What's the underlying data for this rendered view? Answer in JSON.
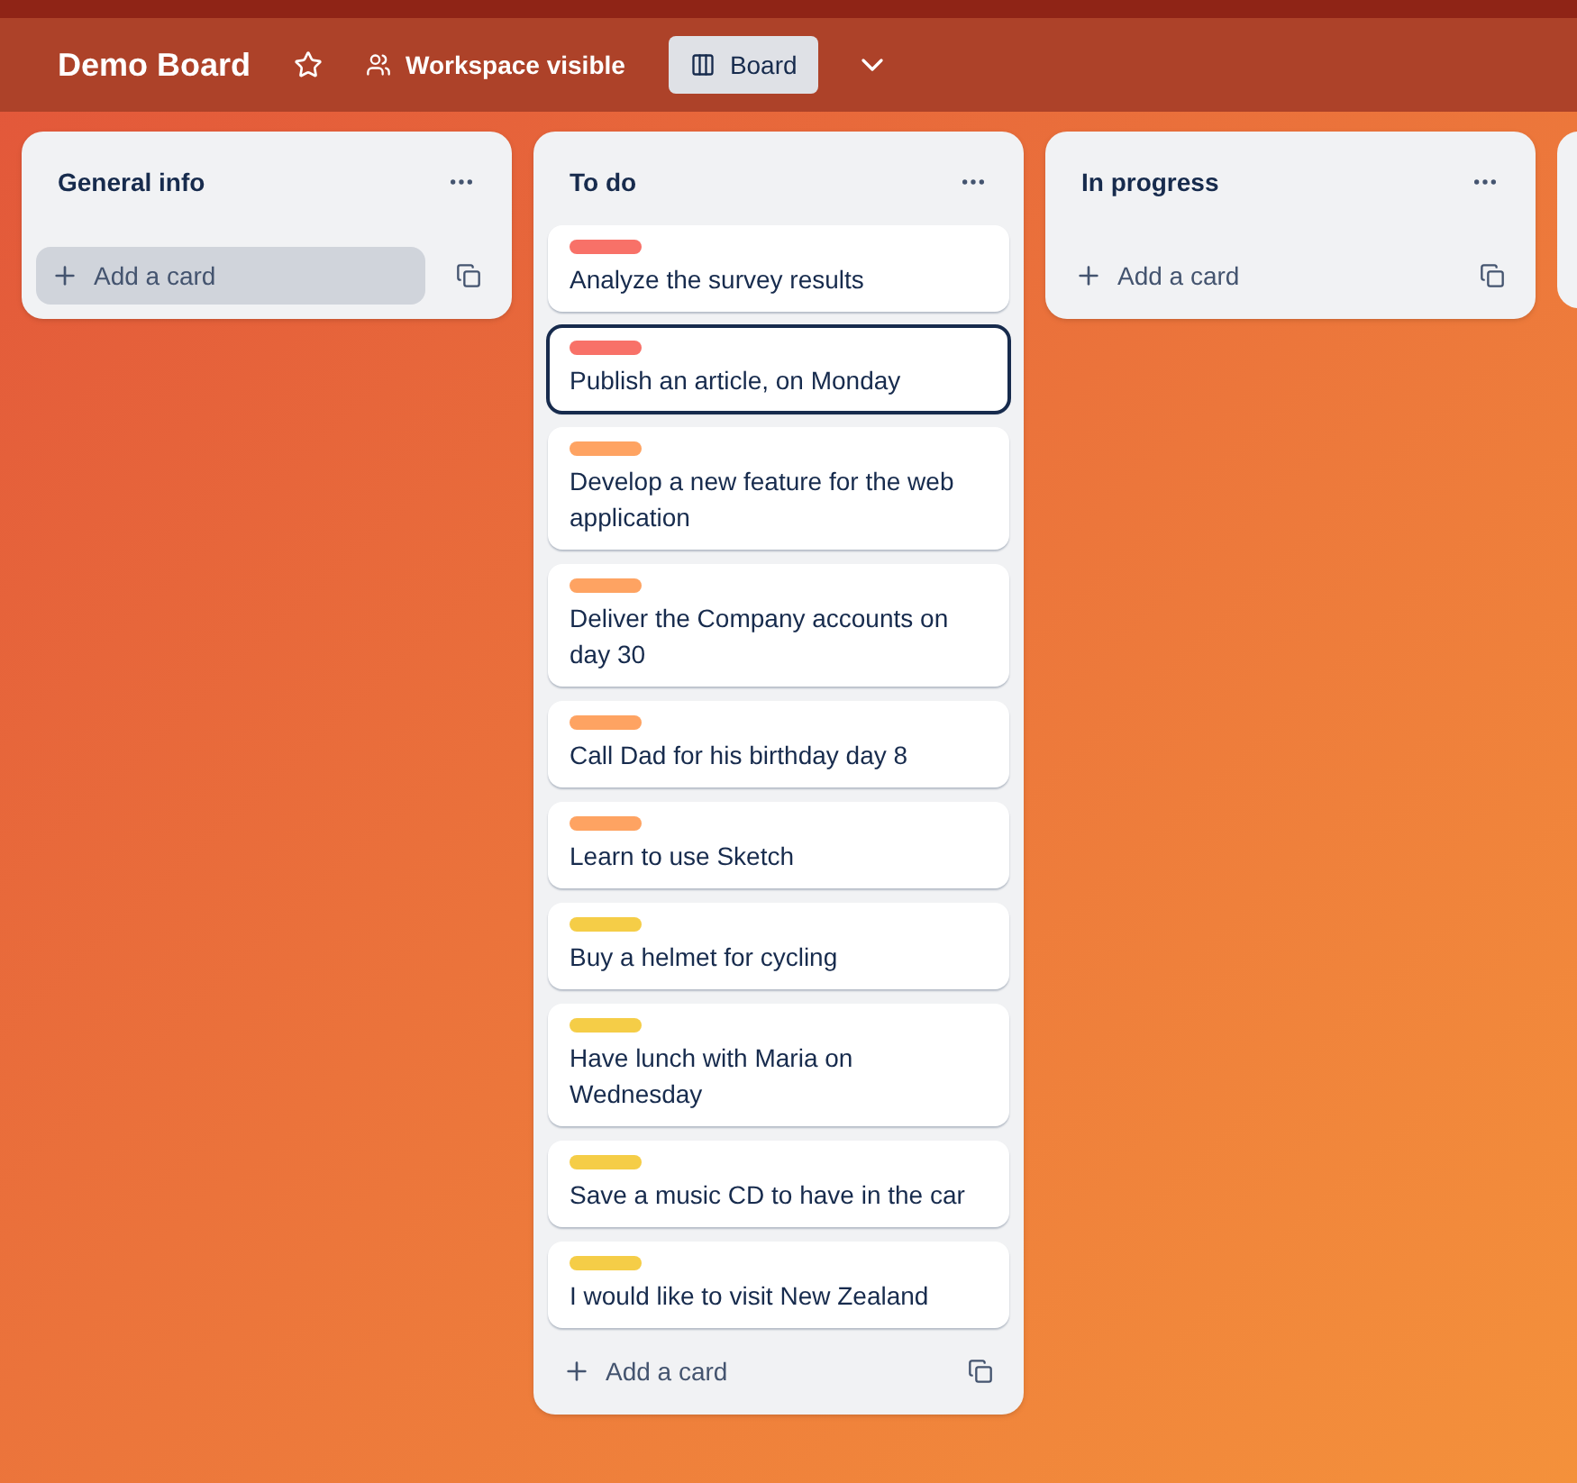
{
  "header": {
    "title": "Demo Board",
    "starred": false,
    "visibility": "Workspace visible",
    "view": "Board"
  },
  "lists": [
    {
      "title": "General info",
      "add_card": {
        "label": "Add a card",
        "highlighted": true
      }
    },
    {
      "title": "To do",
      "cards": [
        {
          "color": "#f87168",
          "text": "Analyze the survey results",
          "selected": false
        },
        {
          "color": "#f87168",
          "text": "Publish an article, on Monday",
          "selected": true
        },
        {
          "color": "#fea362",
          "text": "Develop a new feature for the web application",
          "selected": false
        },
        {
          "color": "#fea362",
          "text": "Deliver the Company accounts on day 30",
          "selected": false
        },
        {
          "color": "#fea362",
          "text": "Call Dad for his birthday day 8",
          "selected": false
        },
        {
          "color": "#fea362",
          "text": "Learn to use Sketch",
          "selected": false
        },
        {
          "color": "#f5cd47",
          "text": "Buy a helmet for cycling",
          "selected": false
        },
        {
          "color": "#f5cd47",
          "text": "Have lunch with Maria on Wednesday",
          "selected": false
        },
        {
          "color": "#f5cd47",
          "text": "Save a music CD to have in the car",
          "selected": false
        },
        {
          "color": "#f5cd47",
          "text": "I would like to visit New Zealand",
          "selected": false
        }
      ],
      "add_card": {
        "label": "Add a card",
        "highlighted": false
      }
    },
    {
      "title": "In progress",
      "add_card": {
        "label": "Add a card",
        "highlighted": false
      }
    }
  ]
}
